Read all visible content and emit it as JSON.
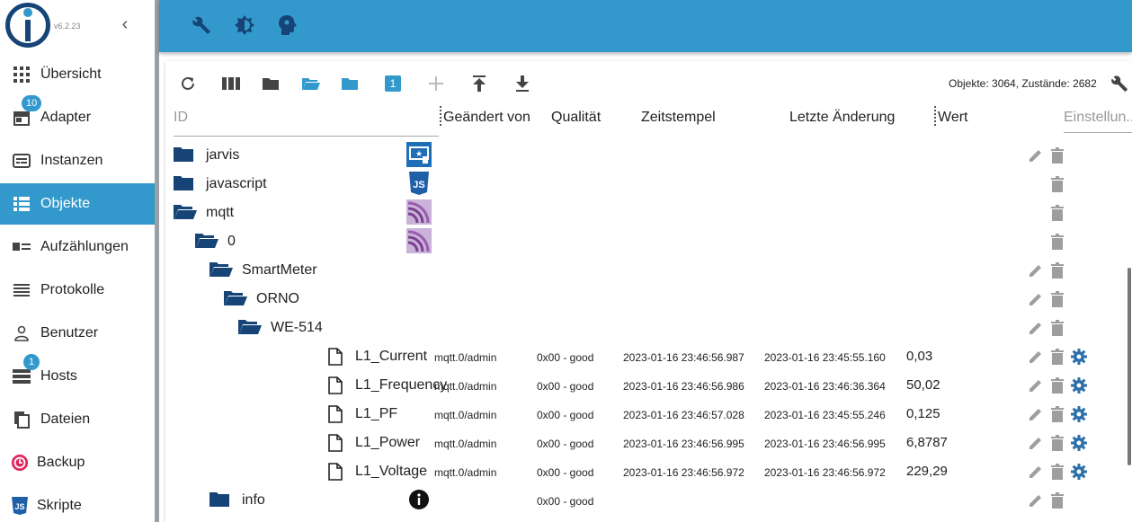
{
  "app": {
    "version": "v6.2.23",
    "collapse_glyph": "‹"
  },
  "sidebar": {
    "items": [
      {
        "label": "Übersicht",
        "icon": "grid-icon"
      },
      {
        "label": "Adapter",
        "icon": "store-icon",
        "badge": "10"
      },
      {
        "label": "Instanzen",
        "icon": "instances-icon"
      },
      {
        "label": "Objekte",
        "icon": "list-icon",
        "active": true
      },
      {
        "label": "Aufzählungen",
        "icon": "enum-icon"
      },
      {
        "label": "Protokolle",
        "icon": "lines-icon"
      },
      {
        "label": "Benutzer",
        "icon": "user-icon"
      },
      {
        "label": "Hosts",
        "icon": "host-icon",
        "badge": "1"
      },
      {
        "label": "Dateien",
        "icon": "files-icon"
      },
      {
        "label": "Backup",
        "icon": "backup-icon"
      },
      {
        "label": "Skripte",
        "icon": "js-icon"
      }
    ]
  },
  "topbar": {
    "icons": [
      "wrench-icon",
      "brightness-icon",
      "expert-head-icon"
    ]
  },
  "toolbar": {
    "counts": "Objekte: 3064, Zustände: 2682",
    "level_badge": "1"
  },
  "table": {
    "headers": {
      "id": "ID",
      "changed_by": "Geändert von",
      "quality": "Qualität",
      "timestamp": "Zeitstempel",
      "last_change": "Letzte Änderung",
      "value": "Wert",
      "settings_placeholder": "Einstellun..."
    },
    "rows": [
      {
        "name": "jarvis",
        "type": "folder",
        "indent": 0,
        "edit": true,
        "settings": false
      },
      {
        "name": "javascript",
        "type": "folder",
        "indent": 0,
        "edit": false,
        "settings": false
      },
      {
        "name": "mqtt",
        "type": "folder-open",
        "indent": 0,
        "edit": false,
        "settings": false
      },
      {
        "name": "0",
        "type": "folder-open",
        "indent": 1,
        "edit": false,
        "settings": false
      },
      {
        "name": "SmartMeter",
        "type": "folder-open",
        "indent": 2,
        "edit": true,
        "settings": false
      },
      {
        "name": "ORNO",
        "type": "folder-open",
        "indent": 3,
        "edit": true,
        "settings": false
      },
      {
        "name": "WE-514",
        "type": "folder-open",
        "indent": 4,
        "edit": true,
        "settings": false
      },
      {
        "name": "L1_Current",
        "type": "file",
        "indent": 5,
        "changed_by": "mqtt.0/admin",
        "quality": "0x00 - good",
        "ts": "2023-01-16 23:46:56.987",
        "lc": "2023-01-16 23:45:55.160",
        "value": "0,03",
        "edit": true,
        "settings": true
      },
      {
        "name": "L1_Frequency",
        "type": "file",
        "indent": 5,
        "changed_by": "mqtt.0/admin",
        "quality": "0x00 - good",
        "ts": "2023-01-16 23:46:56.986",
        "lc": "2023-01-16 23:46:36.364",
        "value": "50,02",
        "edit": true,
        "settings": true
      },
      {
        "name": "L1_PF",
        "type": "file",
        "indent": 5,
        "changed_by": "mqtt.0/admin",
        "quality": "0x00 - good",
        "ts": "2023-01-16 23:46:57.028",
        "lc": "2023-01-16 23:45:55.246",
        "value": "0,125",
        "edit": true,
        "settings": true
      },
      {
        "name": "L1_Power",
        "type": "file",
        "indent": 5,
        "changed_by": "mqtt.0/admin",
        "quality": "0x00 - good",
        "ts": "2023-01-16 23:46:56.995",
        "lc": "2023-01-16 23:46:56.995",
        "value": "6,8787",
        "edit": true,
        "settings": true
      },
      {
        "name": "L1_Voltage",
        "type": "file",
        "indent": 5,
        "changed_by": "mqtt.0/admin",
        "quality": "0x00 - good",
        "ts": "2023-01-16 23:46:56.972",
        "lc": "2023-01-16 23:46:56.972",
        "value": "229,29",
        "edit": true,
        "settings": true
      },
      {
        "name": "info",
        "type": "folder",
        "indent": 2,
        "quality": "0x00 - good",
        "edit": true,
        "settings": false
      }
    ]
  },
  "colors": {
    "brand": "#3399cc",
    "dark_blue": "#164477",
    "folder": "#164477",
    "action_icon": "#9e9e9e",
    "settings_icon": "#2d6fa8"
  }
}
